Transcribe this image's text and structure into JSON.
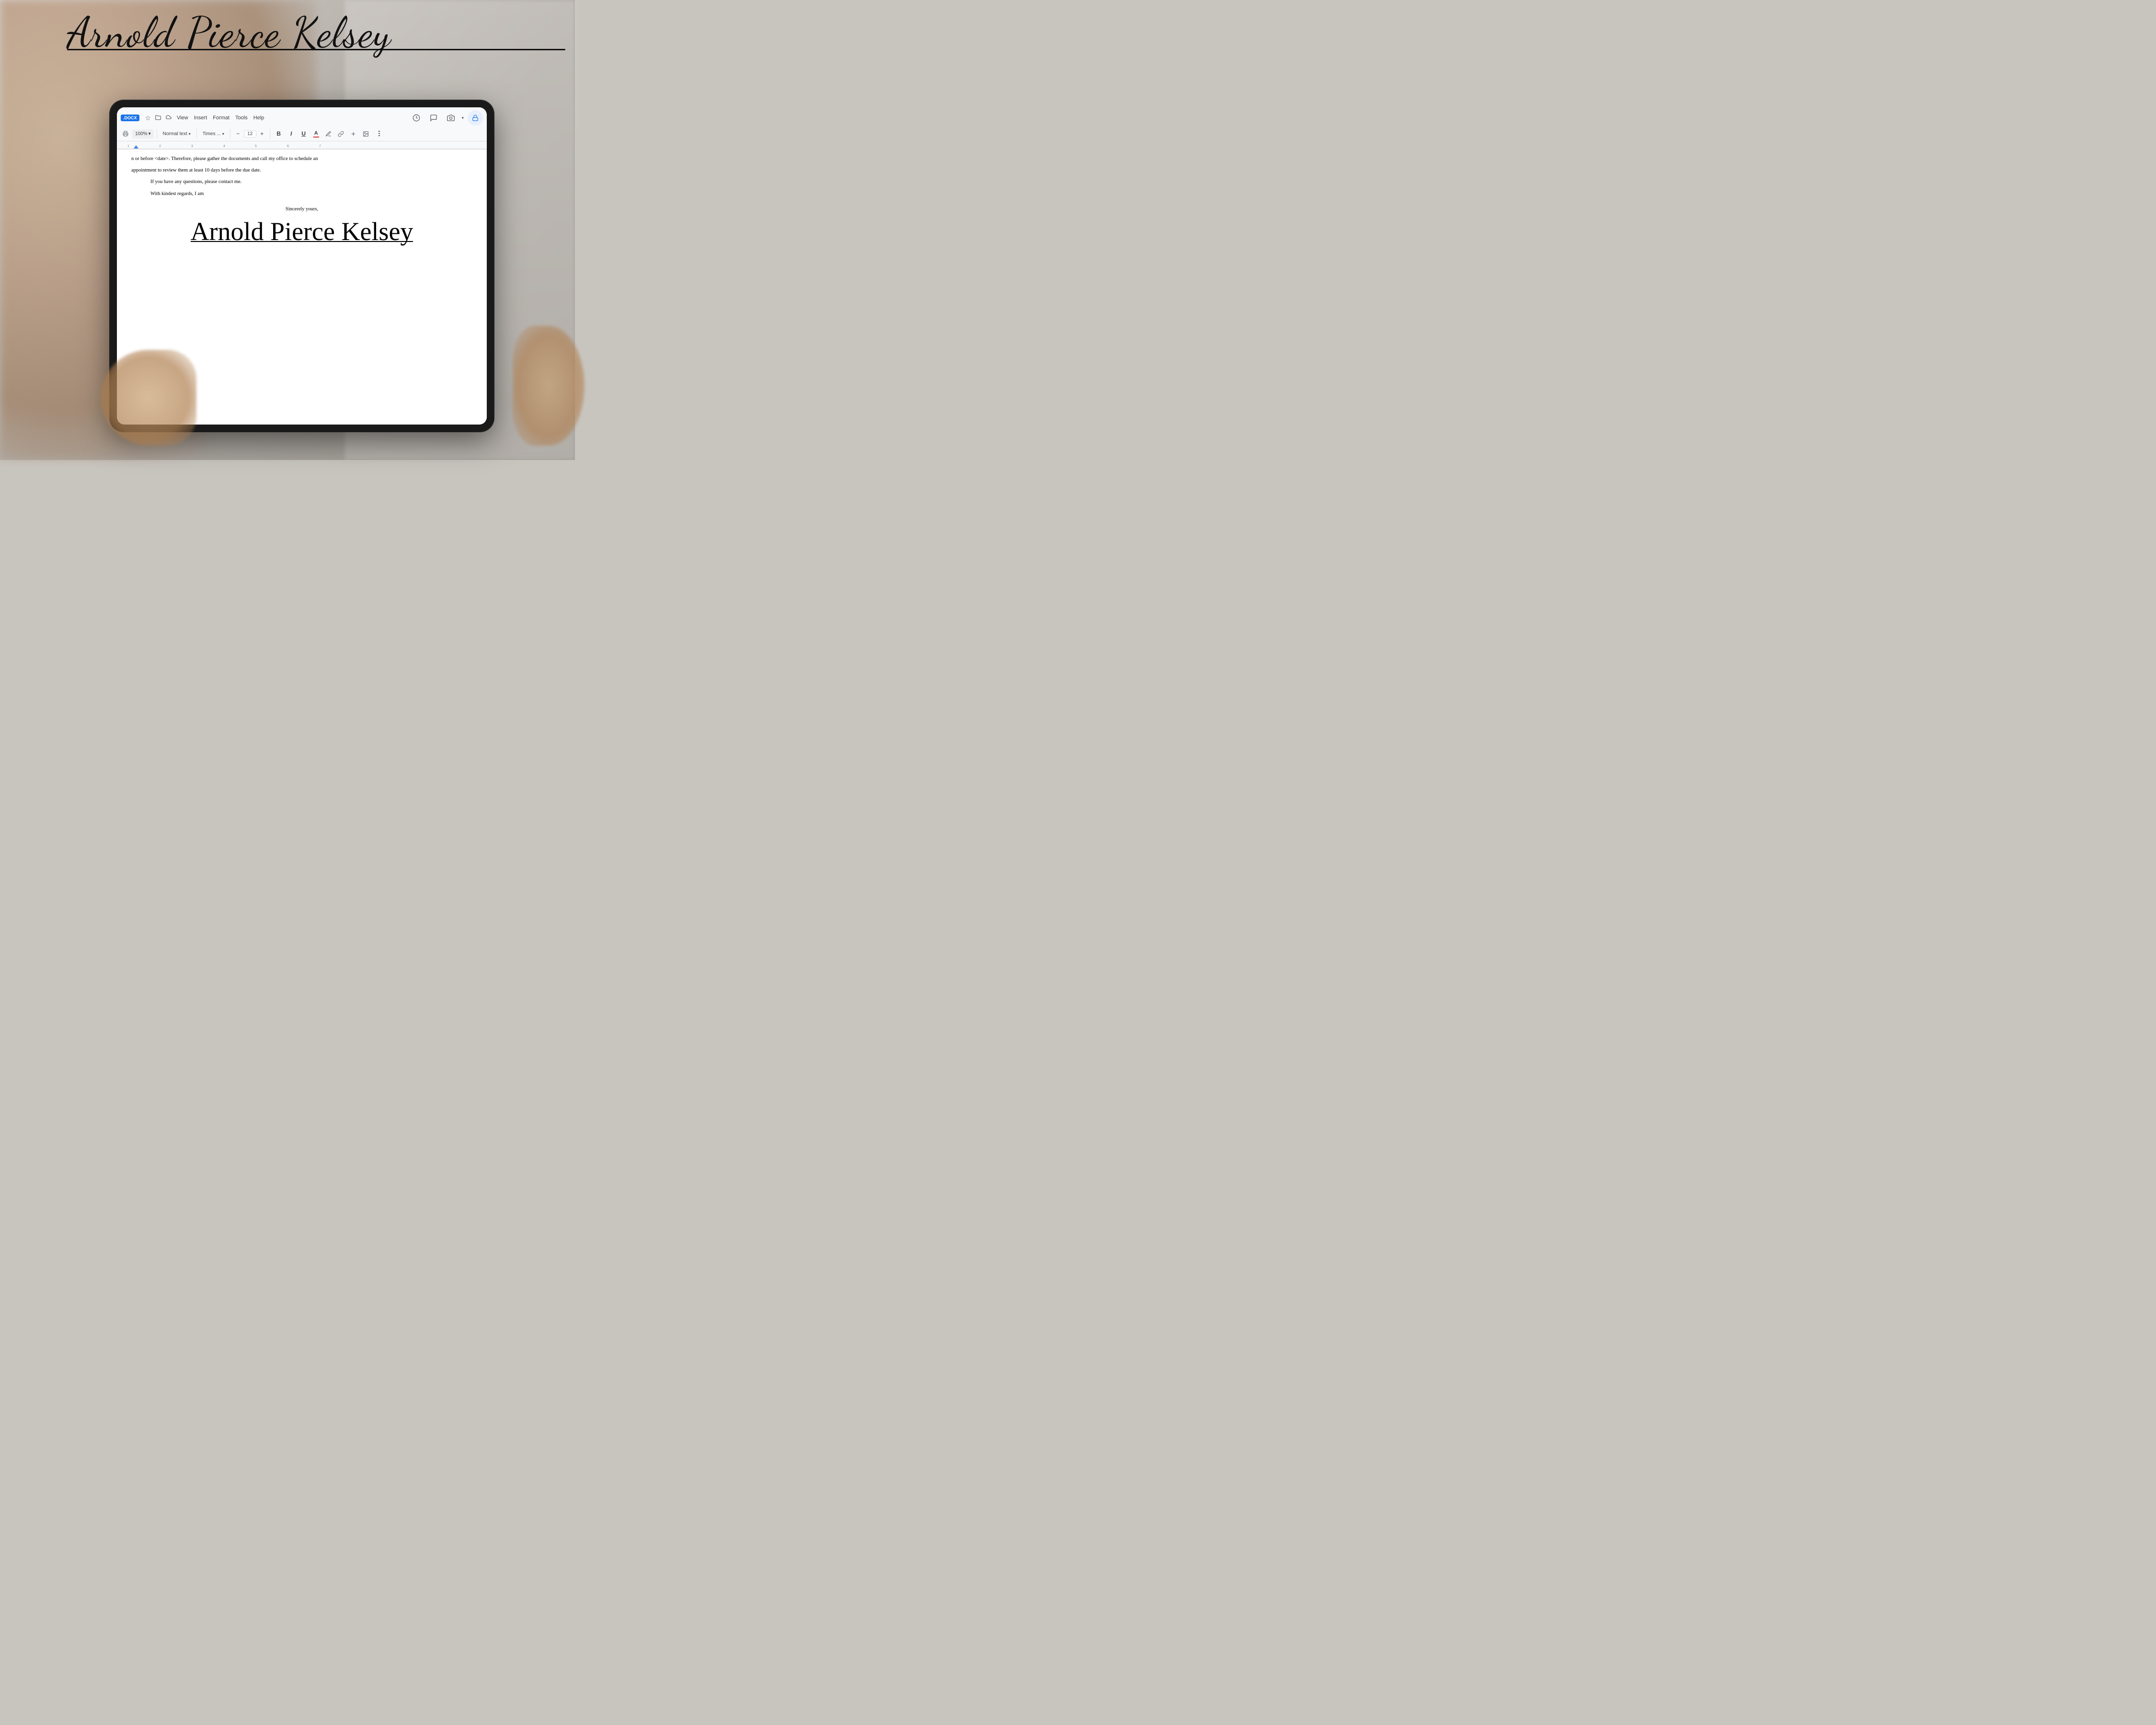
{
  "signature": {
    "name": "Arnold Pierce Kelsey",
    "top_label": "Arnold Pierce Kelsey"
  },
  "toolbar": {
    "docx_badge": ".DOCX",
    "menu_items": [
      "View",
      "Insert",
      "Format",
      "Tools",
      "Help"
    ],
    "zoom": "100%",
    "zoom_chevron": "▾",
    "style_label": "Normal text",
    "style_chevron": "▾",
    "font_label": "Times ...",
    "font_chevron": "▾",
    "font_size": "12",
    "bold": "B",
    "italic": "I",
    "underline": "U",
    "font_color": "A",
    "highlight": "✏",
    "link": "🔗",
    "add": "+",
    "image": "🖼"
  },
  "document": {
    "line1": "n or before <date>.  Therefore, please gather the documents and call my office to schedule an",
    "line2": "appointment to review them at least 10 days before the due date.",
    "paragraph1": "If you have any questions, please contact me.",
    "paragraph2": "With kindest regards, I am",
    "closing": "Sincerely yours,",
    "signature": "Arnold Pierce Kelsey"
  },
  "icons": {
    "star": "☆",
    "folder": "📁",
    "cloud": "☁",
    "history": "🕐",
    "comment": "💬",
    "camera": "📷",
    "lock": "🔒",
    "chevron_down": "▾"
  }
}
